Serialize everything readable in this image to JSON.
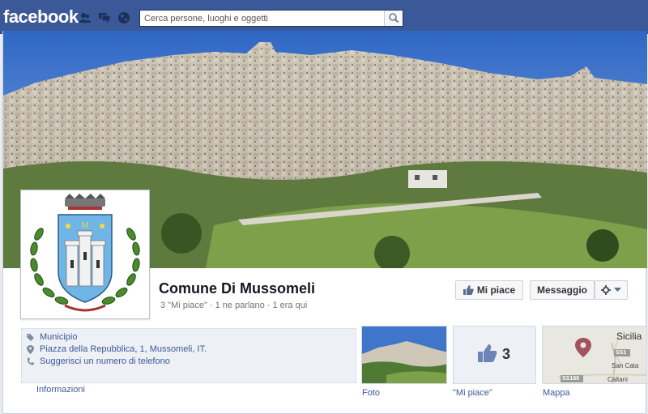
{
  "topbar": {
    "logo": "facebook",
    "search_placeholder": "Cerca persone, luoghi e oggetti"
  },
  "page": {
    "name": "Comune Di Mussomeli",
    "stats": {
      "likes": "3 \"Mi piace\"",
      "talking": "1 ne parlano",
      "checkins": "1 era qui",
      "separator": "·"
    },
    "actions": {
      "like_label": "Mi piace",
      "message_label": "Messaggio"
    },
    "about": {
      "category": "Municipio",
      "address": "Piazza della Repubblica, 1, Mussomeli, IT.",
      "phone_prompt": "Suggerisci un numero di telefono"
    },
    "info_link": "Informazioni",
    "tiles": {
      "photo_label": "Foto",
      "likes_label": "\"Mi piace\"",
      "likes_count": "3",
      "map_label": "Mappa"
    },
    "map": {
      "region": "Sicilia",
      "place_1": "San Cata",
      "place_2": "Caltani",
      "road_1": "SS1",
      "road_2": "SS189"
    }
  },
  "colors": {
    "brand": "#3b5998",
    "link": "#3b5998",
    "page_bg": "#e9ebee"
  }
}
